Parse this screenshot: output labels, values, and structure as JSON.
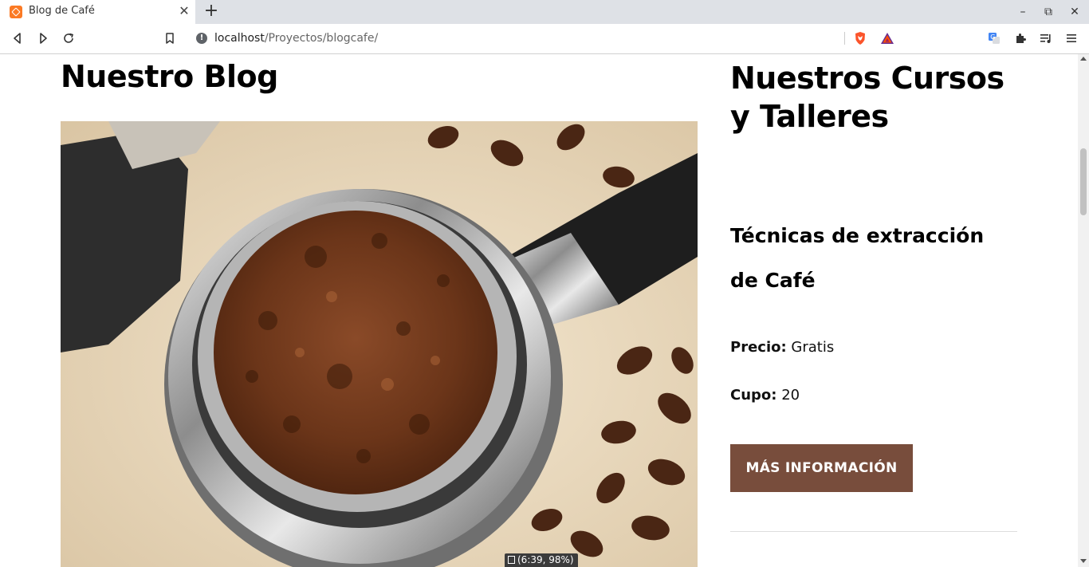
{
  "browser": {
    "tab_title": "Blog de Café",
    "url_host": "localhost",
    "url_path": "/Proyectos/blogcafe/",
    "accent_orange": "#fb7a24"
  },
  "page": {
    "blog_heading": "Nuestro Blog",
    "courses_heading": "Nuestros Cursos y Talleres",
    "course": {
      "name": "Técnicas de extracción de Café",
      "price_label": "Precio:",
      "price_value": "Gratis",
      "quota_label": "Cupo:",
      "quota_value": "20",
      "button_label": "MÁS INFORMACIÓN",
      "button_color": "#784d3c"
    },
    "hero_image": "espresso-portafilter-with-ground-coffee-and-beans"
  },
  "status": {
    "text": "(6:39, 98%)"
  }
}
